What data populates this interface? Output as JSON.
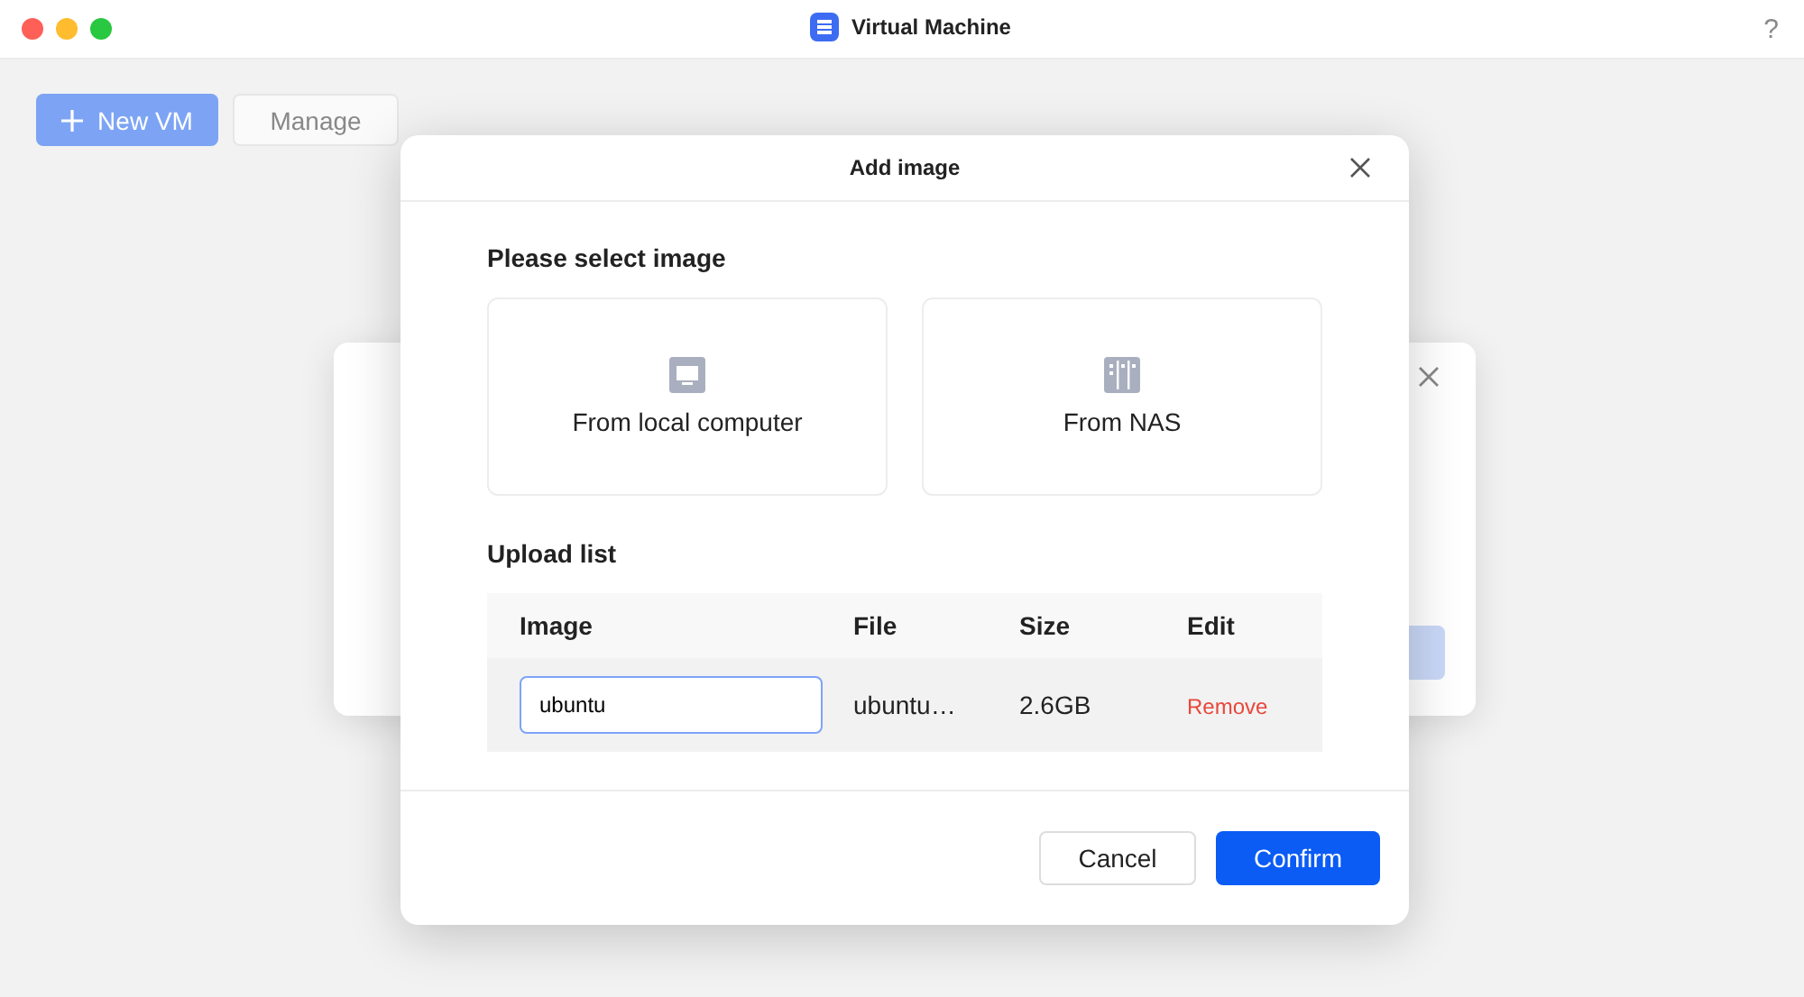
{
  "window": {
    "title": "Virtual Machine",
    "help": "?"
  },
  "toolbar": {
    "buttons": [
      {
        "label": "New VM",
        "kind": "primary"
      },
      {
        "label": "Manage",
        "kind": "secondary"
      }
    ]
  },
  "dialog": {
    "title": "Add image",
    "section_title": "Please select image",
    "sources": [
      {
        "label": "From local computer",
        "kind": "computer"
      },
      {
        "label": "From NAS",
        "kind": "nas"
      }
    ],
    "upload_title": "Upload list",
    "table": {
      "columns": [
        "Image",
        "File",
        "Size",
        "Edit"
      ],
      "rows": [
        {
          "image": "ubuntu",
          "file": "ubuntu…",
          "size": "2.6GB",
          "action": "Remove"
        }
      ]
    },
    "buttons": [
      {
        "label": "Cancel",
        "kind": "secondary"
      },
      {
        "label": "Confirm",
        "kind": "primary"
      }
    ]
  }
}
